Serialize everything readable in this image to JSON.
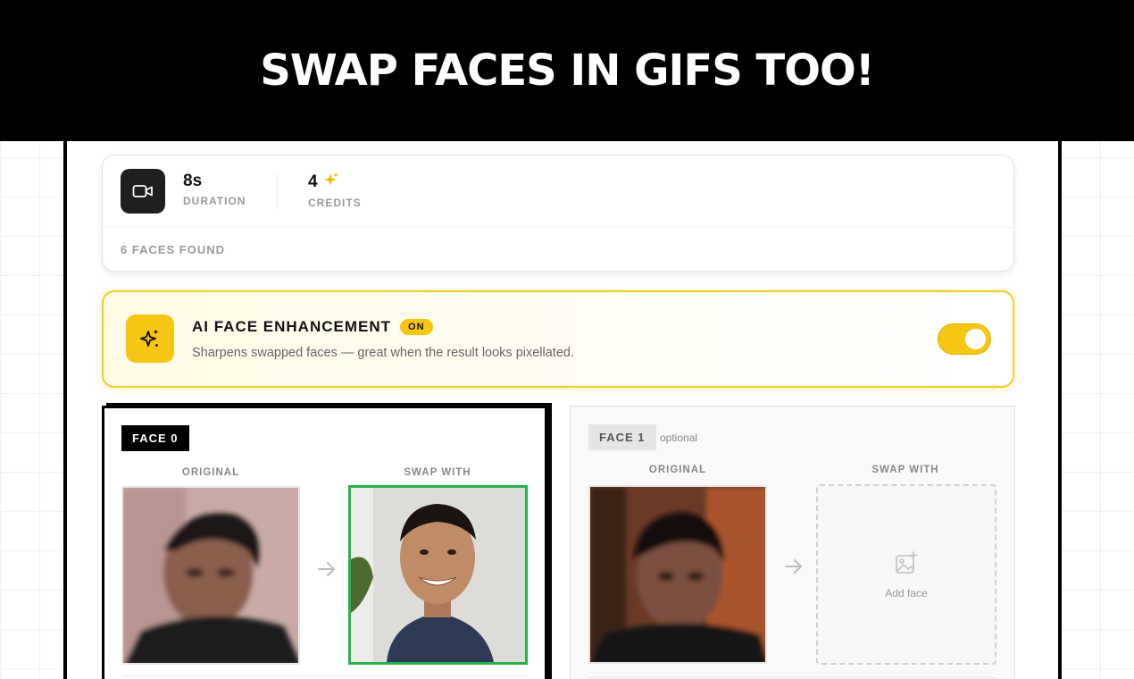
{
  "banner": {
    "title": "SWAP FACES IN GIFS TOO!"
  },
  "stats": {
    "duration_value": "8s",
    "duration_label": "DURATION",
    "credits_value": "4",
    "credits_label": "CREDITS",
    "faces_found": "6 FACES FOUND"
  },
  "enhancement": {
    "title": "AI FACE ENHANCEMENT",
    "badge": "ON",
    "description": "Sharpens swapped faces — great when the result looks pixellated.",
    "enabled": true
  },
  "faces": [
    {
      "tag": "FACE 0",
      "original_label": "ORIGINAL",
      "swap_label": "SWAP WITH",
      "has_swap": true
    },
    {
      "tag": "FACE 1",
      "optional": "optional",
      "original_label": "ORIGINAL",
      "swap_label": "SWAP WITH",
      "add_label": "Add face",
      "has_swap": false
    }
  ],
  "colors": {
    "accent": "#f7c513",
    "selected_border": "#27b24a",
    "banner_bg": "#000000"
  },
  "icons": {
    "video": "video-camera-icon",
    "sparkle": "sparkle-icon",
    "arrow": "arrow-right-icon",
    "add_image": "add-image-icon"
  }
}
